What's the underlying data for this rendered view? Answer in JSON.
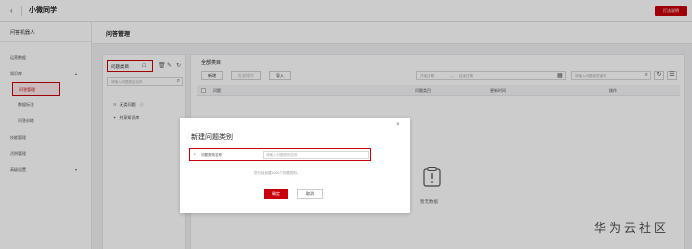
{
  "topbar": {
    "app_title": "小微同学",
    "right_button": "打法说明"
  },
  "sidebar": {
    "header": "问答机器人",
    "items": [
      {
        "label": "运营数据"
      },
      {
        "label": "知识库"
      },
      {
        "label": "问答管理"
      },
      {
        "label": "数据标注"
      },
      {
        "label": "问答训练"
      },
      {
        "label": "技能管理"
      },
      {
        "label": "活例管理"
      },
      {
        "label": "高级设置"
      }
    ]
  },
  "main": {
    "header": "问答管理",
    "category_panel": {
      "title": "问题类目",
      "search_placeholder": "请输入问题类目名称",
      "links": [
        {
          "label": "无类问题"
        },
        {
          "label": "共享知识库"
        }
      ]
    },
    "list_panel": {
      "title": "全部类目",
      "buttons": [
        {
          "label": "新增"
        },
        {
          "label": "批量操作"
        },
        {
          "label": "导入"
        }
      ],
      "date_start_placeholder": "开始日期",
      "date_separator": "—",
      "date_end_placeholder": "结束日期",
      "search_placeholder": "请输入问题或关键字",
      "columns": [
        "问题",
        "问题类目",
        "更新时间",
        "操作"
      ],
      "empty_text": "暂无数据"
    }
  },
  "dialog": {
    "title": "新建问题类别",
    "required_mark": "*",
    "field_label": "问题类别名称",
    "field_placeholder": "请输入问题类别名称",
    "hint": "您已经创建1000个问题类别。",
    "ok_label": "确定",
    "cancel_label": "取消"
  },
  "watermark": "华为云社区",
  "colors": {
    "accent": "#c7000b",
    "background": "#f0f1f3"
  },
  "icons": {
    "back": "back-chevron-icon",
    "add_category": "add-file-icon",
    "delete": "trash-icon",
    "edit": "pencil-icon",
    "refresh": "refresh-icon",
    "search": "search-icon",
    "calendar": "calendar-icon",
    "empty": "empty-clipboard-icon"
  }
}
